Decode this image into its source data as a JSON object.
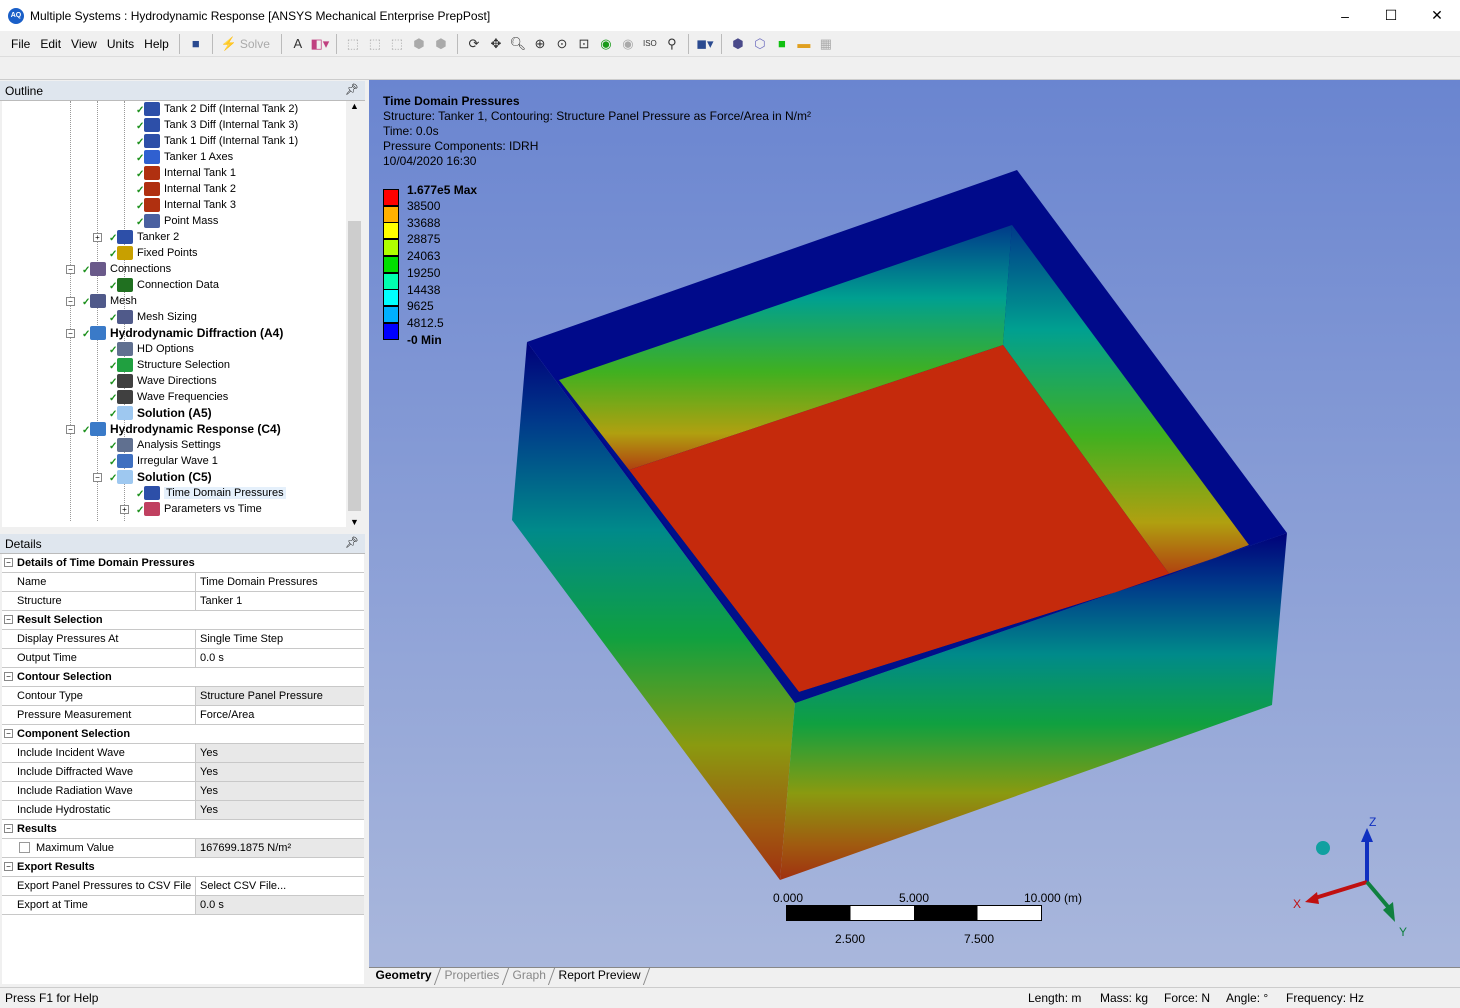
{
  "window": {
    "title": "Multiple Systems : Hydrodynamic Response [ANSYS Mechanical Enterprise PrepPost]",
    "minimize": "–",
    "maximize": "☐",
    "close": "✕"
  },
  "menu": [
    "File",
    "Edit",
    "View",
    "Units",
    "Help"
  ],
  "toolbar": {
    "solve_label": "Solve"
  },
  "outline": {
    "title": "Outline",
    "items": [
      {
        "label": "Tank 2 Diff (Internal Tank 2)",
        "level": 4,
        "icon": "#2d4fa8"
      },
      {
        "label": "Tank 3 Diff (Internal Tank 3)",
        "level": 4,
        "icon": "#2d4fa8"
      },
      {
        "label": "Tank 1 Diff (Internal Tank 1)",
        "level": 4,
        "icon": "#2d4fa8"
      },
      {
        "label": "Tanker 1 Axes",
        "level": 4,
        "icon": "#3060d0"
      },
      {
        "label": "Internal Tank 1",
        "level": 4,
        "icon": "#b03010"
      },
      {
        "label": "Internal Tank 2",
        "level": 4,
        "icon": "#b03010"
      },
      {
        "label": "Internal Tank 3",
        "level": 4,
        "icon": "#b03010"
      },
      {
        "label": "Point Mass",
        "level": 4,
        "icon": "#4a60a0"
      },
      {
        "label": "Tanker 2",
        "level": 3,
        "icon": "#2d4fa8",
        "expander": "+"
      },
      {
        "label": "Fixed Points",
        "level": 3,
        "icon": "#c8a000"
      },
      {
        "label": "Connections",
        "level": 2,
        "icon": "#6a5a8a",
        "expander": "-"
      },
      {
        "label": "Connection Data",
        "level": 3,
        "icon": "#207020"
      },
      {
        "label": "Mesh",
        "level": 2,
        "icon": "#505a8a",
        "expander": "-"
      },
      {
        "label": "Mesh Sizing",
        "level": 3,
        "icon": "#505a8a"
      },
      {
        "label": "Hydrodynamic Diffraction (A4)",
        "level": 2,
        "icon": "#3a7ac8",
        "expander": "-",
        "bold": true
      },
      {
        "label": "HD Options",
        "level": 3,
        "icon": "#607090"
      },
      {
        "label": "Structure Selection",
        "level": 3,
        "icon": "#20a040"
      },
      {
        "label": "Wave Directions",
        "level": 3,
        "icon": "#404040"
      },
      {
        "label": "Wave Frequencies",
        "level": 3,
        "icon": "#404040"
      },
      {
        "label": "Solution (A5)",
        "level": 3,
        "icon": "#9ec8f0",
        "bold": true
      },
      {
        "label": "Hydrodynamic Response (C4)",
        "level": 2,
        "icon": "#3a7ac8",
        "expander": "-",
        "bold": true
      },
      {
        "label": "Analysis Settings",
        "level": 3,
        "icon": "#607090"
      },
      {
        "label": "Irregular Wave 1",
        "level": 3,
        "icon": "#4070c0"
      },
      {
        "label": "Solution (C5)",
        "level": 3,
        "icon": "#9ec8f0",
        "expander": "-",
        "bold": true
      },
      {
        "label": "Time Domain Pressures",
        "level": 4,
        "icon": "#2d4fa8",
        "selected": true
      },
      {
        "label": "Parameters vs Time",
        "level": 4,
        "icon": "#c04060",
        "expander": "+"
      }
    ]
  },
  "details": {
    "title": "Details",
    "rows": [
      {
        "group": "Details of Time Domain Pressures"
      },
      {
        "k": "Name",
        "v": "Time Domain Pressures"
      },
      {
        "k": "Structure",
        "v": "Tanker 1"
      },
      {
        "group": "Result Selection"
      },
      {
        "k": "Display Pressures At",
        "v": "Single Time Step"
      },
      {
        "k": "Output Time",
        "v": "0.0 s"
      },
      {
        "group": "Contour Selection"
      },
      {
        "k": "Contour Type",
        "v": "Structure Panel Pressure",
        "gray": true
      },
      {
        "k": "Pressure Measurement",
        "v": "Force/Area"
      },
      {
        "group": "Component Selection"
      },
      {
        "k": "Include Incident Wave",
        "v": "Yes",
        "gray": true
      },
      {
        "k": "Include Diffracted Wave",
        "v": "Yes",
        "gray": true
      },
      {
        "k": "Include Radiation Wave",
        "v": "Yes",
        "gray": true
      },
      {
        "k": "Include Hydrostatic",
        "v": "Yes",
        "gray": true
      },
      {
        "group": "Results"
      },
      {
        "k": "Maximum Value",
        "v": "167699.1875 N/m²",
        "checkbox": true,
        "gray": true
      },
      {
        "group": "Export Results"
      },
      {
        "k": "Export Panel Pressures to CSV File",
        "v": "Select CSV File..."
      },
      {
        "k": "Export at Time",
        "v": "0.0 s",
        "gray": true
      }
    ]
  },
  "viewport": {
    "title": "Time Domain Pressures",
    "lines": [
      "Structure: Tanker 1, Contouring: Structure Panel Pressure as Force/Area in N/m²",
      "Time: 0.0s",
      "Pressure Components: IDRH",
      "10/04/2020 16:30"
    ],
    "legend": {
      "max": "1.677e5 Max",
      "min": "-0 Min",
      "labels": [
        "38500",
        "33688",
        "28875",
        "24063",
        "19250",
        "14438",
        "9625",
        "4812.5"
      ],
      "colors": [
        "#ff0000",
        "#ffb000",
        "#ffff00",
        "#b0ff00",
        "#00e000",
        "#00ffb0",
        "#00ffff",
        "#00b0ff",
        "#0000ff"
      ]
    },
    "scale": {
      "top": [
        "0.000",
        "5.000",
        "10.000 (m)"
      ],
      "bottom": [
        "2.500",
        "7.500"
      ]
    },
    "triad": {
      "x": "X",
      "y": "Y",
      "z": "Z"
    }
  },
  "tabs": [
    "Geometry",
    "Properties",
    "Graph",
    "Report Preview"
  ],
  "status": {
    "help": "Press F1 for Help",
    "length": "Length: m",
    "mass": "Mass: kg",
    "force": "Force: N",
    "angle": "Angle: °",
    "frequency": "Frequency: Hz"
  }
}
